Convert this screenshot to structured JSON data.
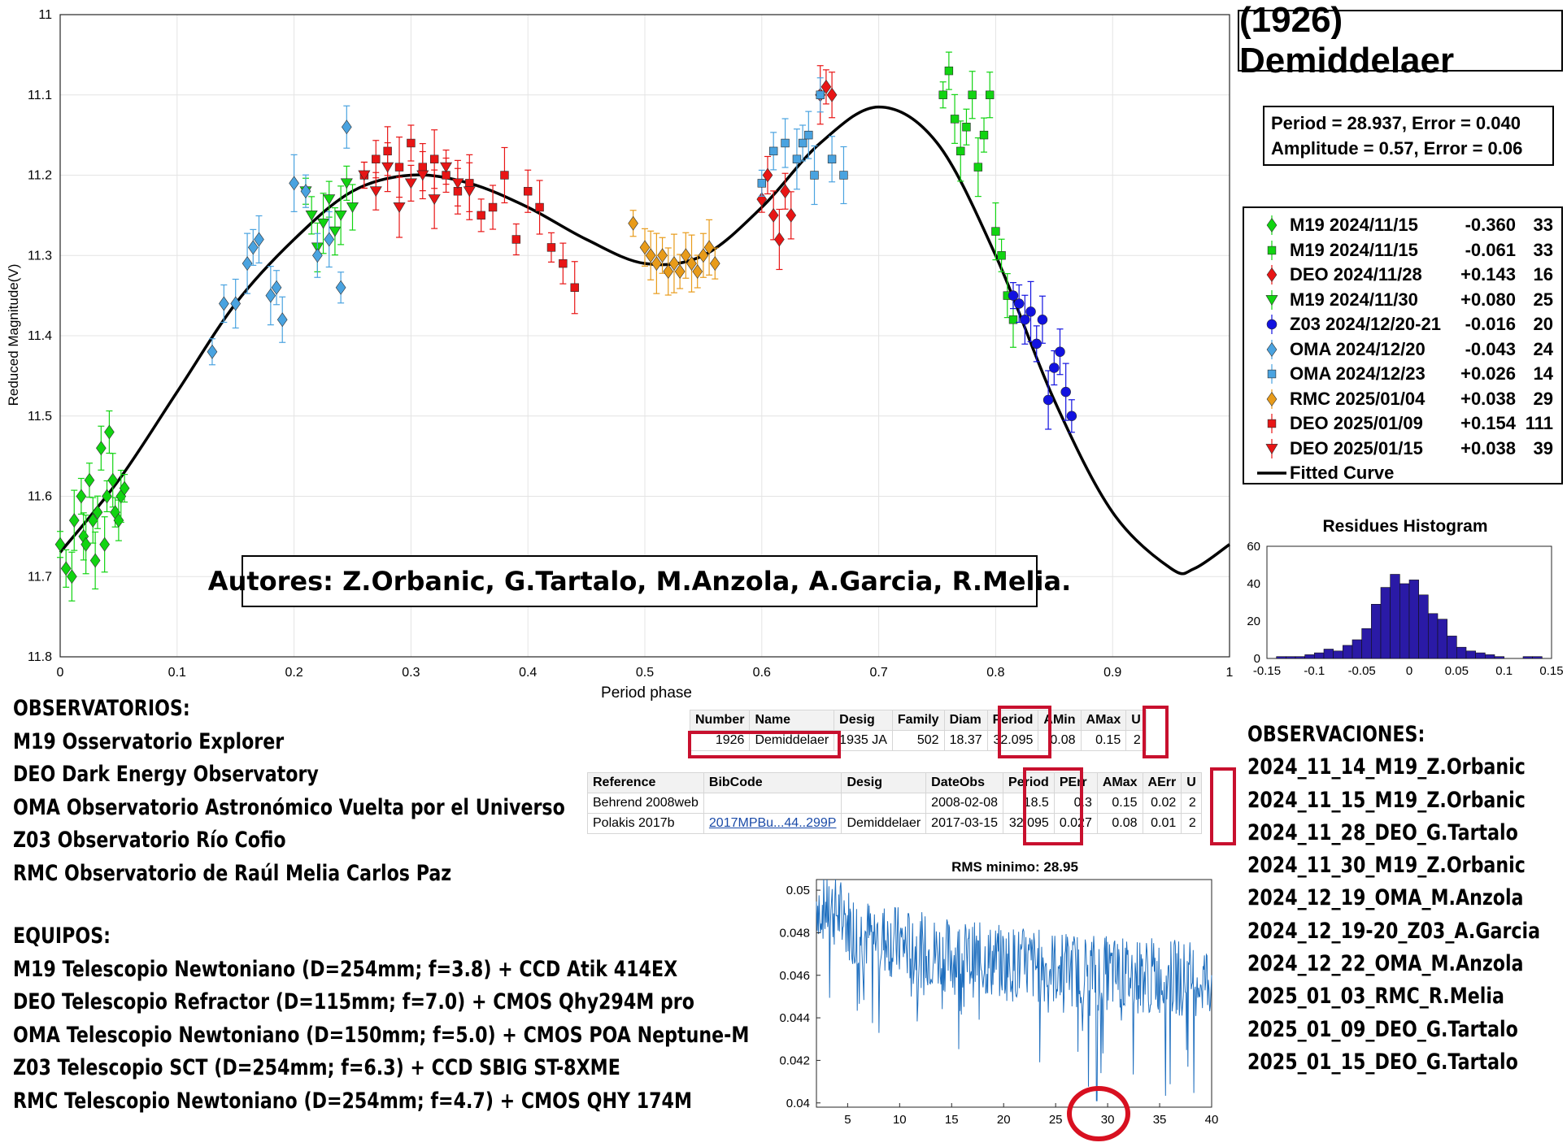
{
  "title": "(1926) Demiddelaer",
  "period_box": {
    "line1": "Period =  28.937, Error = 0.040",
    "line2": "Amplitude = 0.57, Error = 0.06"
  },
  "legend": [
    {
      "label": "M19 2024/11/15",
      "offset": "-0.360",
      "count": "33",
      "color": "#11d411",
      "marker": "diamond"
    },
    {
      "label": "M19 2024/11/15",
      "offset": "-0.061",
      "count": "33",
      "color": "#11d411",
      "marker": "square"
    },
    {
      "label": "DEO 2024/11/28",
      "offset": "+0.143",
      "count": "16",
      "color": "#e81515",
      "marker": "diamond"
    },
    {
      "label": "M19 2024/11/30",
      "offset": "+0.080",
      "count": "25",
      "color": "#11d411",
      "marker": "triangle-down"
    },
    {
      "label": "Z03 2024/12/20-21",
      "offset": "-0.016",
      "count": "20",
      "color": "#1212e0",
      "marker": "circle"
    },
    {
      "label": "OMA 2024/12/20",
      "offset": "-0.043",
      "count": "24",
      "color": "#4aa3e0",
      "marker": "diamond"
    },
    {
      "label": "OMA 2024/12/23",
      "offset": "+0.026",
      "count": "14",
      "color": "#4aa3e0",
      "marker": "square"
    },
    {
      "label": "RMC 2025/01/04",
      "offset": "+0.038",
      "count": "29",
      "color": "#e89b1a",
      "marker": "diamond"
    },
    {
      "label": "DEO 2025/01/09",
      "offset": "+0.154",
      "count": "111",
      "color": "#e81515",
      "marker": "square"
    },
    {
      "label": "DEO 2025/01/15",
      "offset": "+0.038",
      "count": "39",
      "color": "#e81515",
      "marker": "triangle-down"
    },
    {
      "label": "Fitted Curve",
      "offset": "",
      "count": "",
      "color": "#000000",
      "marker": "line"
    }
  ],
  "authors": "Autores: Z.Orbanic, G.Tartalo, M.Anzola, A.Garcia, R.Melia.",
  "observatorios": {
    "heading": "OBSERVATORIOS:",
    "items": [
      "M19 Osservatorio Explorer",
      "DEO Dark Energy Observatory",
      "OMA Observatorio Astronómico Vuelta por el Universo",
      "Z03 Observatorio Río Cofio",
      "RMC Observatorio de Raúl Melia Carlos Paz"
    ]
  },
  "equipos": {
    "heading": "EQUIPOS:",
    "items": [
      "M19 Telescopio Newtoniano (D=254mm; f=3.8) + CCD Atik 414EX",
      "DEO Telescopio Refractor (D=115mm; f=7.0) + CMOS Qhy294M pro",
      "OMA Telescopio Newtoniano (D=150mm; f=5.0) + CMOS POA Neptune-M",
      "Z03 Telescopio SCT (D=254mm; f=6.3) + CCD SBIG ST-8XME",
      "RMC Telescopio Newtoniano (D=254mm; f=4.7) + CMOS QHY 174M"
    ]
  },
  "observaciones": {
    "heading": "OBSERVACIONES:",
    "items": [
      "2024_11_14_M19_Z.Orbanic",
      "2024_11_15_M19_Z.Orbanic",
      "2024_11_28_DEO_G.Tartalo",
      "2024_11_30_M19_Z.Orbanic",
      "2024_12_19_OMA_M.Anzola",
      "2024_12_19-20_Z03_A.Garcia",
      "2024_12_22_OMA_M.Anzola",
      "2025_01_03_RMC_R.Melia",
      "2025_01_09_DEO_G.Tartalo",
      "2025_01_15_DEO_G.Tartalo"
    ]
  },
  "table1": {
    "headers": [
      "Number",
      "Name",
      "Desig",
      "Family",
      "Diam",
      "Period",
      "AMin",
      "AMax",
      "U"
    ],
    "row": [
      "1926",
      "Demiddelaer",
      "1935 JA",
      "502",
      "18.37",
      "32.095",
      "0.08",
      "0.15",
      "2"
    ]
  },
  "table2": {
    "headers": [
      "Reference",
      "BibCode",
      "Desig",
      "DateObs",
      "Period",
      "PErr",
      "AMax",
      "AErr",
      "U"
    ],
    "rows": [
      [
        "Behrend 2008web",
        "",
        "",
        "2008-02-08",
        "18.5",
        "0.3",
        "0.15",
        "0.02",
        "2"
      ],
      [
        "Polakis 2017b",
        "2017MPBu...44..299P",
        "Demiddelaer",
        "2017-03-15",
        "32.095",
        "0.027",
        "0.08",
        "0.01",
        "2"
      ]
    ]
  },
  "chart_data": [
    {
      "type": "scatter",
      "xlabel": "Period phase",
      "ylabel": "Reduced Magnitude(V)",
      "xlim": [
        0,
        1
      ],
      "ylim": [
        11.8,
        11
      ],
      "y_reversed": true,
      "xticks": [
        "0",
        "0.1",
        "0.2",
        "0.3",
        "0.4",
        "0.5",
        "0.6",
        "0.7",
        "0.8",
        "0.9",
        "1"
      ],
      "yticks": [
        "11",
        "11.1",
        "11.2",
        "11.3",
        "11.4",
        "11.5",
        "11.6",
        "11.7",
        "11.8"
      ],
      "grid": true,
      "fitted_curve": {
        "name": "Fitted Curve",
        "x": [
          0,
          0.05,
          0.1,
          0.15,
          0.2,
          0.25,
          0.3,
          0.35,
          0.4,
          0.45,
          0.5,
          0.55,
          0.6,
          0.65,
          0.7,
          0.75,
          0.8,
          0.85,
          0.9,
          0.95,
          0.97,
          1
        ],
        "y": [
          11.67,
          11.58,
          11.47,
          11.36,
          11.28,
          11.22,
          11.2,
          11.21,
          11.24,
          11.28,
          11.31,
          11.3,
          11.24,
          11.16,
          11.115,
          11.16,
          11.3,
          11.48,
          11.62,
          11.69,
          11.69,
          11.66
        ]
      },
      "series": [
        {
          "name": "M19 2024/11/15",
          "marker": "diamond",
          "color": "#11d411",
          "x": [
            0.0,
            0.005,
            0.01,
            0.012,
            0.018,
            0.02,
            0.022,
            0.025,
            0.028,
            0.03,
            0.032,
            0.035,
            0.038,
            0.04,
            0.042,
            0.045,
            0.047,
            0.05,
            0.052,
            0.055
          ],
          "y": [
            11.66,
            11.69,
            11.7,
            11.63,
            11.6,
            11.65,
            11.66,
            11.58,
            11.63,
            11.68,
            11.62,
            11.54,
            11.66,
            11.6,
            11.52,
            11.58,
            11.62,
            11.63,
            11.6,
            11.59
          ]
        },
        {
          "name": "M19 2024/11/15",
          "marker": "square",
          "color": "#11d411",
          "x": [
            0.755,
            0.76,
            0.765,
            0.77,
            0.775,
            0.78,
            0.785,
            0.79,
            0.795,
            0.8,
            0.805,
            0.81,
            0.815
          ],
          "y": [
            11.1,
            11.07,
            11.13,
            11.17,
            11.14,
            11.1,
            11.19,
            11.15,
            11.1,
            11.27,
            11.3,
            11.35,
            11.38
          ]
        },
        {
          "name": "DEO 2024/11/28",
          "marker": "diamond",
          "color": "#e81515",
          "x": [
            0.6,
            0.605,
            0.61,
            0.615,
            0.62,
            0.625,
            0.65,
            0.655,
            0.66
          ],
          "y": [
            11.23,
            11.2,
            11.25,
            11.28,
            11.22,
            11.25,
            11.1,
            11.09,
            11.1
          ]
        },
        {
          "name": "M19 2024/11/30",
          "marker": "triangle-down",
          "color": "#11d411",
          "x": [
            0.21,
            0.215,
            0.22,
            0.225,
            0.23,
            0.235,
            0.24,
            0.245,
            0.25
          ],
          "y": [
            11.22,
            11.25,
            11.29,
            11.26,
            11.23,
            11.27,
            11.25,
            11.21,
            11.24
          ]
        },
        {
          "name": "Z03 2024/12/20-21",
          "marker": "circle",
          "color": "#1212e0",
          "x": [
            0.815,
            0.82,
            0.825,
            0.83,
            0.835,
            0.84,
            0.845,
            0.85,
            0.855,
            0.86,
            0.865
          ],
          "y": [
            11.35,
            11.36,
            11.38,
            11.37,
            11.41,
            11.38,
            11.48,
            11.44,
            11.42,
            11.47,
            11.5
          ]
        },
        {
          "name": "OMA 2024/12/20",
          "marker": "diamond",
          "color": "#4aa3e0",
          "x": [
            0.13,
            0.14,
            0.15,
            0.16,
            0.165,
            0.17,
            0.18,
            0.185,
            0.19,
            0.2,
            0.21,
            0.22,
            0.23,
            0.24,
            0.245
          ],
          "y": [
            11.42,
            11.36,
            11.36,
            11.31,
            11.29,
            11.28,
            11.35,
            11.34,
            11.38,
            11.21,
            11.22,
            11.3,
            11.28,
            11.34,
            11.14
          ]
        },
        {
          "name": "OMA 2024/12/23",
          "marker": "square",
          "color": "#4aa3e0",
          "x": [
            0.6,
            0.61,
            0.62,
            0.63,
            0.635,
            0.64,
            0.645,
            0.65,
            0.66,
            0.67
          ],
          "y": [
            11.21,
            11.17,
            11.16,
            11.18,
            11.16,
            11.15,
            11.2,
            11.1,
            11.18,
            11.2
          ]
        },
        {
          "name": "RMC 2025/01/04",
          "marker": "diamond",
          "color": "#e89b1a",
          "x": [
            0.49,
            0.5,
            0.505,
            0.51,
            0.515,
            0.52,
            0.525,
            0.53,
            0.535,
            0.54,
            0.545,
            0.55,
            0.555,
            0.56
          ],
          "y": [
            11.26,
            11.29,
            11.3,
            11.31,
            11.3,
            11.32,
            11.31,
            11.32,
            11.3,
            11.31,
            11.32,
            11.3,
            11.29,
            11.31
          ]
        },
        {
          "name": "DEO 2025/01/09",
          "marker": "square",
          "color": "#e81515",
          "x": [
            0.26,
            0.27,
            0.28,
            0.29,
            0.3,
            0.31,
            0.32,
            0.33,
            0.34,
            0.35,
            0.36,
            0.37,
            0.38,
            0.39,
            0.4,
            0.41,
            0.42,
            0.43,
            0.44
          ],
          "y": [
            11.2,
            11.18,
            11.17,
            11.19,
            11.16,
            11.19,
            11.18,
            11.2,
            11.22,
            11.21,
            11.25,
            11.24,
            11.2,
            11.28,
            11.22,
            11.24,
            11.29,
            11.31,
            11.34
          ]
        },
        {
          "name": "DEO 2025/01/15",
          "marker": "triangle-down",
          "color": "#e81515",
          "x": [
            0.26,
            0.27,
            0.28,
            0.29,
            0.3,
            0.31,
            0.32,
            0.33,
            0.34,
            0.35
          ],
          "y": [
            11.2,
            11.22,
            11.19,
            11.24,
            11.21,
            11.2,
            11.23,
            11.19,
            11.21,
            11.22
          ]
        }
      ]
    },
    {
      "type": "bar",
      "title": "Residues Histogram",
      "xlim": [
        -0.15,
        0.15
      ],
      "ylim": [
        0,
        60
      ],
      "xticks": [
        "-0.15",
        "-0.1",
        "-0.05",
        "0",
        "0.05",
        "0.1",
        "0.15"
      ],
      "yticks": [
        "0",
        "20",
        "40",
        "60"
      ],
      "color": "#2a1aa6",
      "bin_width": 0.01,
      "bin_centers": [
        -0.135,
        -0.125,
        -0.115,
        -0.105,
        -0.095,
        -0.085,
        -0.075,
        -0.065,
        -0.055,
        -0.045,
        -0.035,
        -0.025,
        -0.015,
        -0.005,
        0.005,
        0.015,
        0.025,
        0.035,
        0.045,
        0.055,
        0.065,
        0.075,
        0.085,
        0.095,
        0.105,
        0.115,
        0.125,
        0.135
      ],
      "values": [
        1,
        1,
        1,
        2,
        3,
        5,
        4,
        7,
        10,
        16,
        29,
        38,
        45,
        40,
        42,
        34,
        24,
        21,
        12,
        6,
        4,
        3,
        2,
        1,
        0,
        0,
        1,
        1
      ]
    },
    {
      "type": "line",
      "title": "RMS minimo: 28.95",
      "xlim": [
        2,
        40
      ],
      "ylim": [
        0.0398,
        0.0505
      ],
      "xticks": [
        "5",
        "10",
        "15",
        "20",
        "25",
        "30",
        "35",
        "40"
      ],
      "yticks": [
        "0.04",
        "0.042",
        "0.044",
        "0.046",
        "0.048",
        "0.05"
      ],
      "color": "#1f6fbf",
      "minimum_x": 28.95,
      "x": [
        2,
        4,
        6,
        8,
        10,
        12,
        14,
        16,
        18,
        20,
        22,
        24,
        26,
        28,
        28.95,
        30,
        32,
        34,
        36,
        38,
        40
      ],
      "y": [
        0.0495,
        0.049,
        0.048,
        0.0478,
        0.0475,
        0.0472,
        0.047,
        0.0468,
        0.0467,
        0.0466,
        0.0465,
        0.0464,
        0.0463,
        0.0462,
        0.0401,
        0.0461,
        0.046,
        0.046,
        0.0459,
        0.0459,
        0.0458
      ]
    }
  ]
}
